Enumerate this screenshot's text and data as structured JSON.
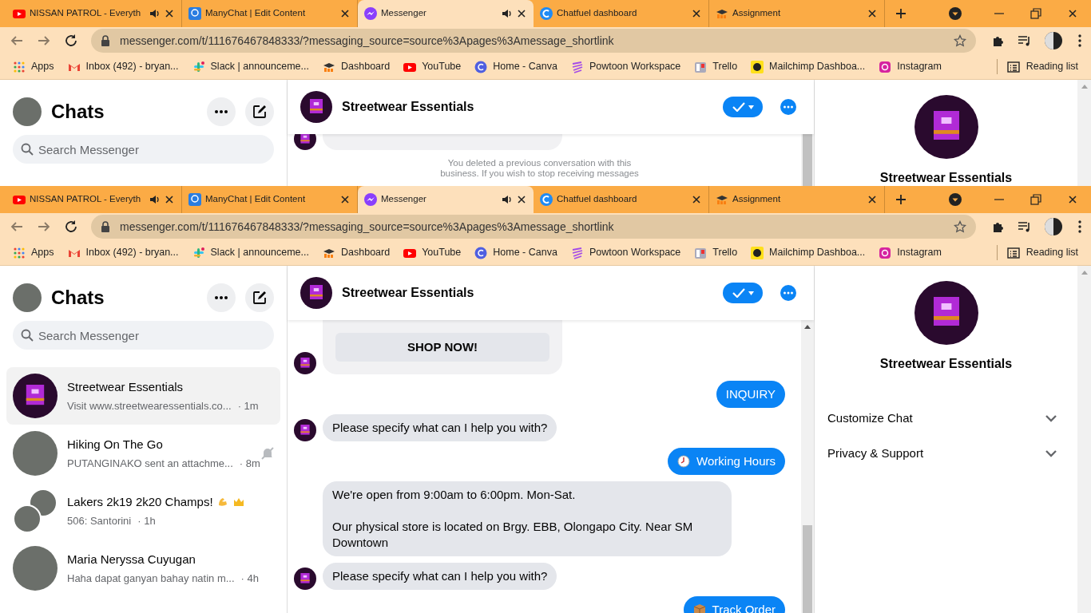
{
  "screens": [
    {
      "browser": {
        "tabs": [
          {
            "label": "NISSAN PATROL - Everyth",
            "selected": false,
            "audio": true
          },
          {
            "label": "ManyChat | Edit Content",
            "selected": false,
            "audio": false
          },
          {
            "label": "Messenger",
            "selected": true,
            "audio": true
          },
          {
            "label": "Chatfuel dashboard",
            "selected": false,
            "audio": false
          },
          {
            "label": "Assignment",
            "selected": false,
            "audio": false
          }
        ],
        "url": "messenger.com/t/111676467848333/?messaging_source=source%3Apages%3Amessage_shortlink",
        "bookmarks": [
          {
            "label": "Apps"
          },
          {
            "label": "Inbox (492) - bryan..."
          },
          {
            "label": "Slack | announceme..."
          },
          {
            "label": "Dashboard"
          },
          {
            "label": "YouTube"
          },
          {
            "label": "Home - Canva"
          },
          {
            "label": "Powtoon Workspace"
          },
          {
            "label": "Trello"
          },
          {
            "label": "Mailchimp Dashboa..."
          },
          {
            "label": "Instagram"
          }
        ],
        "reading_list": "Reading list"
      },
      "messenger": {
        "sidebar": {
          "title": "Chats",
          "search": {
            "placeholder": "Search Messenger"
          }
        },
        "conversation": {
          "name": "Streetwear Essentials",
          "messages": [
            {
              "kind": "card"
            },
            {
              "kind": "notice",
              "text": "You deleted a previous conversation with this business. If you wish to stop receiving messages"
            }
          ]
        },
        "details": {
          "name": "Streetwear Essentials"
        }
      }
    },
    {
      "browser": {
        "tabs": [
          {
            "label": "NISSAN PATROL - Everyth",
            "selected": false,
            "audio": true
          },
          {
            "label": "ManyChat | Edit Content",
            "selected": false,
            "audio": false
          },
          {
            "label": "Messenger",
            "selected": true,
            "audio": true
          },
          {
            "label": "Chatfuel dashboard",
            "selected": false,
            "audio": false
          },
          {
            "label": "Assignment",
            "selected": false,
            "audio": false
          }
        ],
        "url": "messenger.com/t/111676467848333/?messaging_source=source%3Apages%3Amessage_shortlink",
        "bookmarks": [
          {
            "label": "Apps"
          },
          {
            "label": "Inbox (492) - bryan..."
          },
          {
            "label": "Slack | announceme..."
          },
          {
            "label": "Dashboard"
          },
          {
            "label": "YouTube"
          },
          {
            "label": "Home - Canva"
          },
          {
            "label": "Powtoon Workspace"
          },
          {
            "label": "Trello"
          },
          {
            "label": "Mailchimp Dashboa..."
          },
          {
            "label": "Instagram"
          }
        ],
        "reading_list": "Reading list"
      },
      "messenger": {
        "sidebar": {
          "title": "Chats",
          "search": {
            "placeholder": "Search Messenger"
          },
          "chats": [
            {
              "name": "Streetwear Essentials",
              "preview": "Visit www.streetwearessentials.co...",
              "time": "· 1m",
              "selected": true,
              "muted": false
            },
            {
              "name": "Hiking On The Go",
              "preview": "PUTANGINAKO sent an attachme...",
              "time": "· 8m",
              "selected": false,
              "muted": true
            },
            {
              "name": "Lakers 2k19 2k20 Champs!",
              "preview": "506: Santorini",
              "time": "· 1h",
              "selected": false,
              "muted": false
            },
            {
              "name": "Maria Neryssa Cuyugan",
              "preview": "Haha dapat ganyan bahay natin m...",
              "time": "· 4h",
              "selected": false,
              "muted": false
            }
          ]
        },
        "conversation": {
          "name": "Streetwear Essentials",
          "messages": [
            {
              "kind": "card",
              "button": "SHOP NOW!"
            },
            {
              "kind": "sent",
              "text": "INQUIRY"
            },
            {
              "kind": "received",
              "text": "Please specify what can I help you with?"
            },
            {
              "kind": "sent",
              "text": "Working Hours"
            },
            {
              "kind": "received",
              "text": "We're open from 9:00am to 6:00pm. Mon-Sat.\n\nOur physical store is located on Brgy. EBB, Olongapo City. Near SM Downtown"
            },
            {
              "kind": "received",
              "text": "Please specify what can I help you with?"
            },
            {
              "kind": "sent",
              "text": "Track Order"
            }
          ]
        },
        "details": {
          "name": "Streetwear Essentials",
          "sections": [
            {
              "label": "Customize Chat",
              "expanded": false
            },
            {
              "label": "Privacy & Support",
              "expanded": false
            }
          ]
        }
      }
    }
  ]
}
